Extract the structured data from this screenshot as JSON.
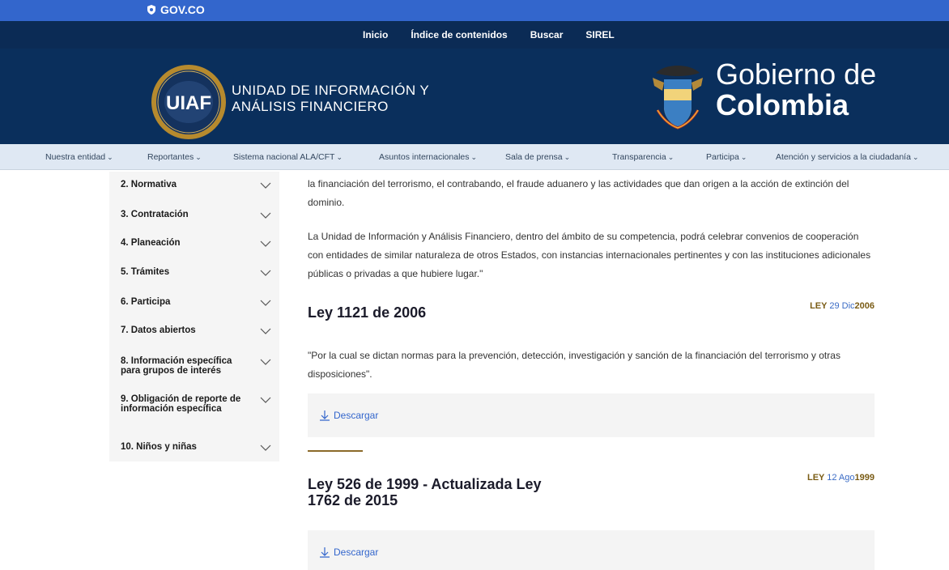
{
  "gov_bar": {
    "logo_text": "GOV.CO"
  },
  "top_nav": {
    "links": [
      "Inicio",
      "Índice de contenidos",
      "Buscar",
      "SIREL"
    ]
  },
  "header": {
    "entity_name_line1": "UNIDAD DE INFORMACIÓN Y",
    "entity_name_line2": "ANÁLISIS FINANCIERO",
    "seal_text": "UIAF",
    "gov_line1": "Gobierno de",
    "gov_line2": "Colombia"
  },
  "main_menu": {
    "items": [
      "Nuestra entidad",
      "Reportantes",
      "Sistema nacional ALA/CFT",
      "Asuntos internacionales",
      "Sala de prensa",
      "Transparencia",
      "Participa",
      "Atención y servicios a la ciudadanía"
    ]
  },
  "sidebar": {
    "items": [
      {
        "label": "2. Normativa"
      },
      {
        "label": "3. Contratación"
      },
      {
        "label": "4. Planeación"
      },
      {
        "label": "5. Trámites"
      },
      {
        "label": "6. Participa"
      },
      {
        "label": "7. Datos abiertos"
      },
      {
        "label": "8. Información específica para grupos de interés"
      },
      {
        "label": "9. Obligación de reporte de información específica"
      },
      {
        "label": "10. Niños y niñas"
      }
    ]
  },
  "content": {
    "intro_p1": "la financiación del terrorismo, el contrabando, el fraude aduanero y las actividades que dan origen a la acción de extinción del dominio.",
    "intro_p2": "La Unidad de Información y Análisis Financiero, dentro del ámbito de su competencia, podrá celebrar convenios de cooperación con entidades de similar naturaleza de otros Estados, con instancias internacionales pertinentes y con las instituciones adicionales públicas o privadas a que hubiere lugar.\"",
    "laws": [
      {
        "title": "Ley 1121 de 2006",
        "type": "LEY",
        "daymonth": "29 Dic",
        "year": "2006",
        "description": "\"Por la cual se dictan normas para la prevención, detección, investigación y sanción de la financiación del terrorismo y otras disposiciones\".",
        "download_label": "Descargar"
      },
      {
        "title": "Ley 526 de 1999 - Actualizada Ley 1762 de 2015",
        "type": "LEY",
        "daymonth": "12 Ago",
        "year": "1999",
        "description": "",
        "download_label": "Descargar"
      }
    ]
  },
  "colors": {
    "gov_blue": "#3366cc",
    "nav_dark": "#0b2b55",
    "banner": "#0a2f5c",
    "menu_bg": "#dfe8f3",
    "accent_gold": "#8b6a2a",
    "link_blue": "#3366cc"
  }
}
